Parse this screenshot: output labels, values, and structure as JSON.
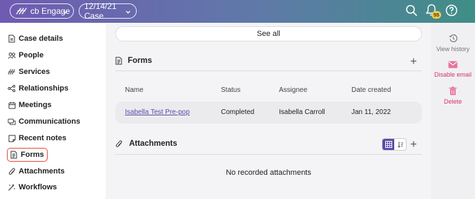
{
  "header": {
    "app_label": "cb Engage",
    "case_label": "12/14/21 Case",
    "notification_count": "55",
    "colors": {
      "gradient_start": "#6f5bb2",
      "gradient_end": "#3f8e87",
      "badge": "#f2c94c"
    }
  },
  "sidebar": {
    "items": [
      {
        "label": "Case details",
        "icon": "document-icon"
      },
      {
        "label": "People",
        "icon": "people-icon"
      },
      {
        "label": "Services",
        "icon": "services-icon"
      },
      {
        "label": "Relationships",
        "icon": "relationships-icon"
      },
      {
        "label": "Meetings",
        "icon": "calendar-icon"
      },
      {
        "label": "Communications",
        "icon": "communications-icon"
      },
      {
        "label": "Recent notes",
        "icon": "note-icon"
      },
      {
        "label": "Forms",
        "icon": "form-icon",
        "active": true
      },
      {
        "label": "Attachments",
        "icon": "paperclip-icon"
      },
      {
        "label": "Workflows",
        "icon": "workflow-icon"
      }
    ]
  },
  "main": {
    "see_all_label": "See all",
    "forms": {
      "title": "Forms",
      "columns": [
        "Name",
        "Status",
        "Assignee",
        "Date created"
      ],
      "rows": [
        {
          "name": "Isabella Test Pre-pop",
          "status": "Completed",
          "assignee": "Isabella Carroll",
          "date_created": "Jan 11, 2022"
        }
      ]
    },
    "attachments": {
      "title": "Attachments",
      "empty_text": "No recorded attachments"
    }
  },
  "rail": {
    "items": [
      {
        "label": "View history",
        "color": "#777777"
      },
      {
        "label": "Disable email",
        "color": "#d6336c"
      },
      {
        "label": "Delete",
        "color": "#d6336c"
      }
    ]
  },
  "accent_color": "#5b4ba8"
}
